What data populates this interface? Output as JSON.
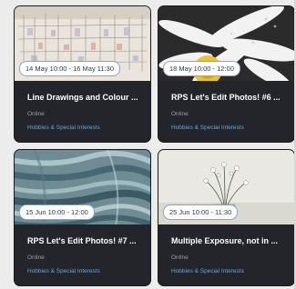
{
  "events": [
    {
      "date": "14 May 10:00 - 16 May 11:30",
      "title": "Line Drawings and Colour ...",
      "location": "Online",
      "category": "Hobbies & Special Interests"
    },
    {
      "date": "18 May 10:00 - 12:00",
      "title": "RPS Let's Edit Photos! #6 ...",
      "location": "Online",
      "category": "Hobbies & Special Interests"
    },
    {
      "date": "15 Jun 10:00 - 12:00",
      "title": "RPS Let's Edit Photos! #7 ...",
      "location": "Online",
      "category": "Hobbies & Special Interests"
    },
    {
      "date": "25 Jun 10:00 - 11:30",
      "title": "Multiple Exposure, not in ...",
      "location": "Online",
      "category": "Hobbies & Special Interests"
    }
  ],
  "colors": {
    "card_bg": "#23252a",
    "link": "#5fa8e8",
    "muted": "#9aa0a6"
  }
}
